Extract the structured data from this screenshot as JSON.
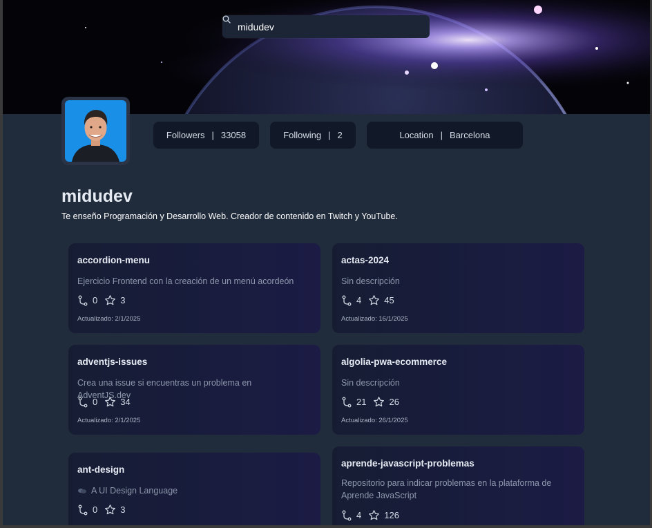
{
  "search": {
    "value": "midudev",
    "icon": "search-icon"
  },
  "profile": {
    "name": "midudev",
    "bio": "Te enseño Programación y Desarrollo Web. Creador de contenido en Twitch y YouTube.",
    "stats": {
      "followers_label": "Followers",
      "followers_value": "33058",
      "following_label": "Following",
      "following_value": "2",
      "location_label": "Location",
      "location_value": "Barcelona",
      "separator": "|"
    }
  },
  "repos": [
    {
      "name": "accordion-menu",
      "description": "Ejercicio Frontend con la creación de un menú acordeón",
      "forks": "0",
      "stars": "3",
      "updated": "Actualizado: 2/1/2025"
    },
    {
      "name": "actas-2024",
      "description": "Sin descripción",
      "forks": "4",
      "stars": "45",
      "updated": "Actualizado: 16/1/2025"
    },
    {
      "name": "adventjs-issues",
      "description": "Crea una issue si encuentras un problema en AdventJS.dev",
      "forks": "0",
      "stars": "34",
      "updated": "Actualizado: 2/1/2025"
    },
    {
      "name": "algolia-pwa-ecommerce",
      "description": "Sin descripción",
      "forks": "21",
      "stars": "26",
      "updated": "Actualizado: 26/1/2025"
    },
    {
      "name": "ant-design",
      "description": "A UI Design Language",
      "forks": "0",
      "stars": "3",
      "updated": ""
    },
    {
      "name": "aprende-javascript-problemas",
      "description": "Repositorio para indicar problemas en la plataforma de Aprende JavaScript",
      "forks": "4",
      "stars": "126",
      "updated": ""
    }
  ],
  "colors": {
    "background": "#202b3b",
    "card_start": "#161d33",
    "card_end": "#1b1b45",
    "stat_bg": "#111827"
  }
}
